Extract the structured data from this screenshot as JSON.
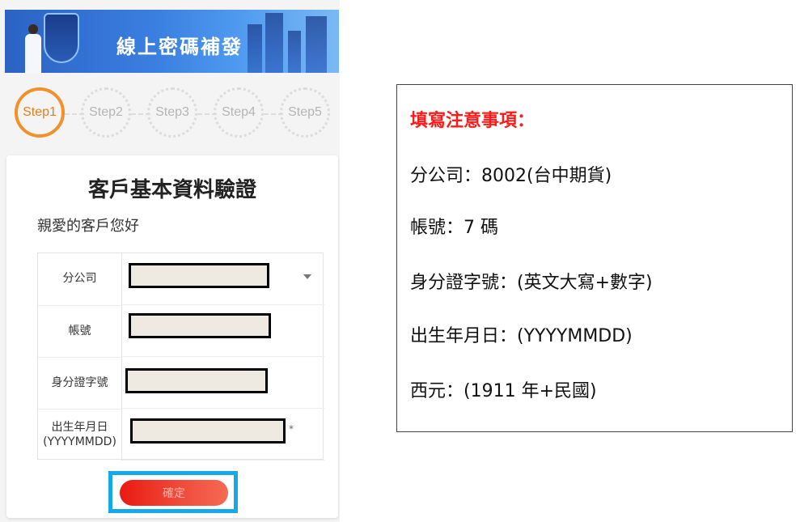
{
  "banner": {
    "title": "線上密碼補發"
  },
  "steps": [
    "Step1",
    "Step2",
    "Step3",
    "Step4",
    "Step5"
  ],
  "card": {
    "title": "客戶基本資料驗證",
    "greeting": "親愛的客戶您好",
    "fields": [
      {
        "label": "分公司",
        "value": ""
      },
      {
        "label": "帳號",
        "value": ""
      },
      {
        "label": "身分證字號",
        "value": ""
      },
      {
        "label": "出生年月日\n(YYYYMMDD)",
        "value": ""
      }
    ],
    "required_mark": "*",
    "submit_label": "確定"
  },
  "notes": {
    "title": "填寫注意事項：",
    "items": [
      "分公司：8002(台中期貨)",
      "帳號：7 碼",
      "身分證字號：(英文大寫+數字)",
      "出生年月日：(YYYYMMDD)",
      "西元：(1911 年+民國)"
    ]
  },
  "colors": {
    "step_active": "#f2902a",
    "submit_button": "#e91b12",
    "highlight_frame": "#16a9e8",
    "notes_title": "#ff1a1a"
  },
  "icons": [
    "shield-icon",
    "person-illustration",
    "dropdown-arrow-icon"
  ]
}
